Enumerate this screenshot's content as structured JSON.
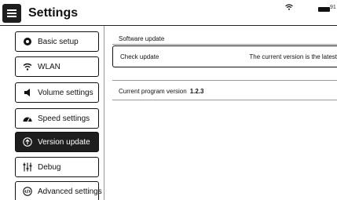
{
  "header": {
    "title": "Settings",
    "battery_text": "91"
  },
  "sidebar": {
    "items": [
      {
        "label": "Basic setup",
        "icon": "record-icon",
        "active": false
      },
      {
        "label": "WLAN",
        "icon": "wifi-icon",
        "active": false
      },
      {
        "label": "Volume settings",
        "icon": "speaker-icon",
        "active": false
      },
      {
        "label": "Speed settings",
        "icon": "speedometer-icon",
        "active": false
      },
      {
        "label": "Version update",
        "icon": "upload-circle-icon",
        "active": true
      },
      {
        "label": "Debug",
        "icon": "sliders-icon",
        "active": false
      },
      {
        "label": "Advanced settings",
        "icon": "code-circle-icon",
        "active": false
      }
    ]
  },
  "content": {
    "section_label": "Software update",
    "check_label": "Check update",
    "check_status": "The current version is the latest",
    "version_label": "Current program version",
    "version_value": "1.2.3"
  },
  "colors": {
    "active_bg": "#1e1e1e",
    "border": "#111111",
    "background": "#ffffff"
  }
}
